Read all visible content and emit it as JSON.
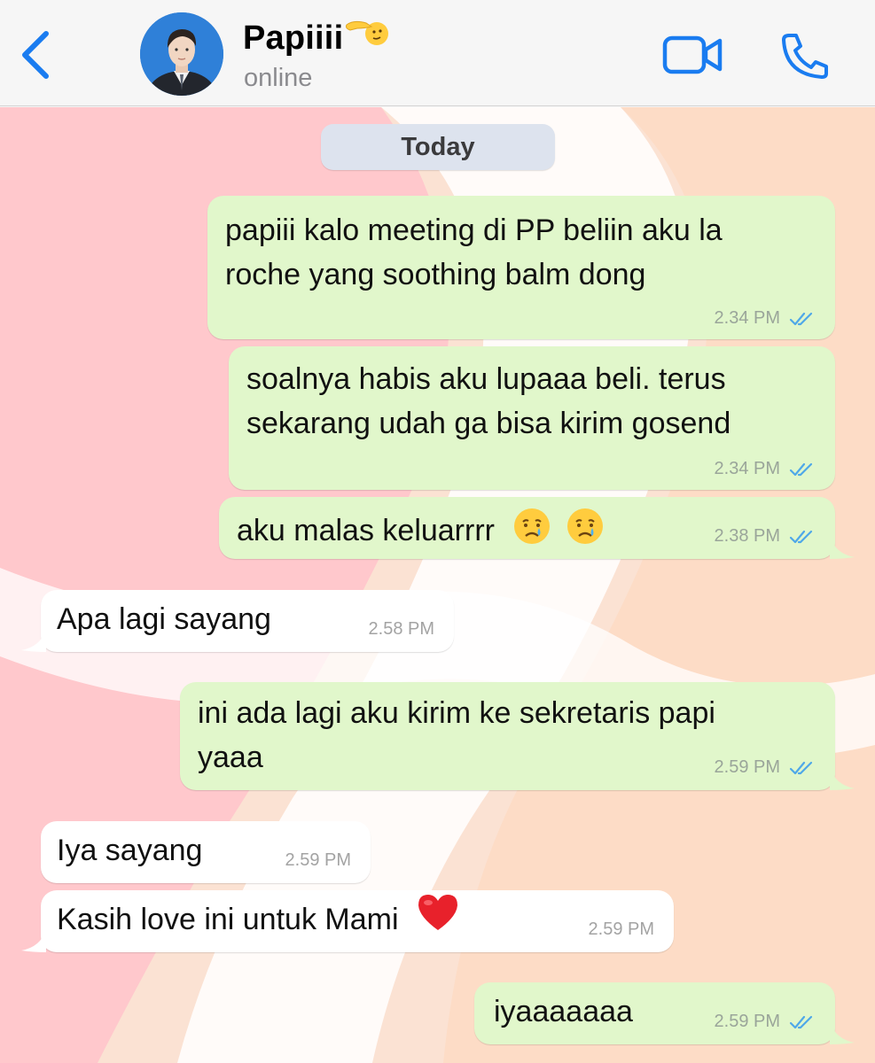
{
  "header": {
    "back_icon": "chevron-left-icon",
    "contact_name": "Papiiii",
    "status": "online",
    "video_icon": "video-camera-icon",
    "call_icon": "phone-icon",
    "accent_color": "#1a7cf0"
  },
  "date_label": "Today",
  "messages": [
    {
      "direction": "out",
      "lines": [
        "papiii kalo meeting di PP beliin aku la",
        "roche yang soothing balm dong"
      ],
      "time": "2.34 PM",
      "read": true
    },
    {
      "direction": "out",
      "lines": [
        "soalnya habis aku lupaaa beli. terus",
        "sekarang udah ga bisa kirim gosend"
      ],
      "time": "2.34 PM",
      "read": true
    },
    {
      "direction": "out",
      "text": "aku malas keluarrrr",
      "time": "2.38 PM",
      "read": true,
      "emoji": "crying-face-icon"
    },
    {
      "direction": "in",
      "text": "Apa lagi sayang",
      "time": "2.58 PM"
    },
    {
      "direction": "out",
      "lines": [
        "ini ada lagi aku kirim ke sekretaris papi",
        "yaaa"
      ],
      "time": "2.59 PM",
      "read": true
    },
    {
      "direction": "in",
      "text": "Iya sayang",
      "time": "2.59 PM"
    },
    {
      "direction": "in",
      "text": "Kasih love ini untuk Mami",
      "time": "2.59 PM",
      "emoji": "red-heart-icon"
    },
    {
      "direction": "out",
      "text": "iyaaaaaaa",
      "time": "2.59 PM",
      "read": true
    }
  ],
  "colors": {
    "outgoing_bubble": "#e1f7cb",
    "incoming_bubble": "#ffffff",
    "read_ticks": "#4fa8e8",
    "wallpaper_pink": "#ffc8cc",
    "wallpaper_peach": "#fddcc6"
  }
}
